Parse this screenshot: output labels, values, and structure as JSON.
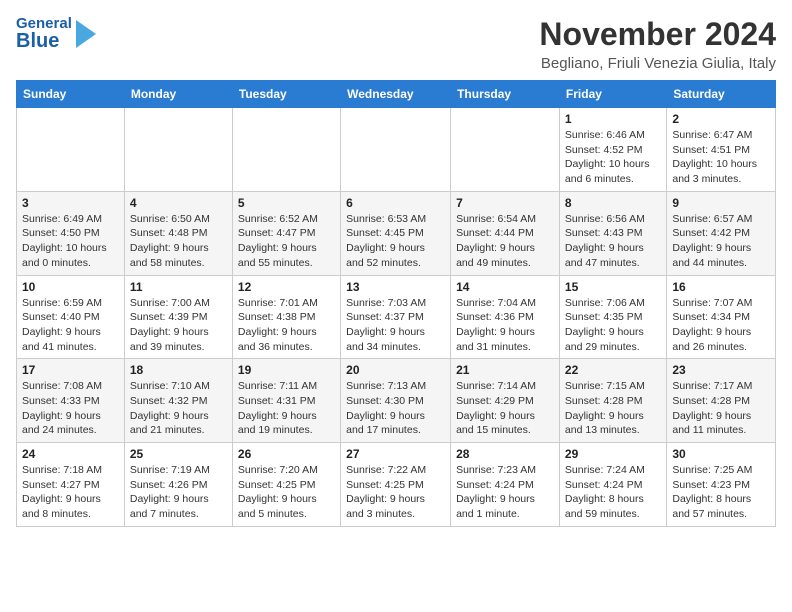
{
  "header": {
    "logo_general": "General",
    "logo_blue": "Blue",
    "title": "November 2024",
    "subtitle": "Begliano, Friuli Venezia Giulia, Italy"
  },
  "days_of_week": [
    "Sunday",
    "Monday",
    "Tuesday",
    "Wednesday",
    "Thursday",
    "Friday",
    "Saturday"
  ],
  "weeks": [
    {
      "days": [
        {
          "num": "",
          "detail": ""
        },
        {
          "num": "",
          "detail": ""
        },
        {
          "num": "",
          "detail": ""
        },
        {
          "num": "",
          "detail": ""
        },
        {
          "num": "",
          "detail": ""
        },
        {
          "num": "1",
          "detail": "Sunrise: 6:46 AM\nSunset: 4:52 PM\nDaylight: 10 hours\nand 6 minutes."
        },
        {
          "num": "2",
          "detail": "Sunrise: 6:47 AM\nSunset: 4:51 PM\nDaylight: 10 hours\nand 3 minutes."
        }
      ]
    },
    {
      "days": [
        {
          "num": "3",
          "detail": "Sunrise: 6:49 AM\nSunset: 4:50 PM\nDaylight: 10 hours\nand 0 minutes."
        },
        {
          "num": "4",
          "detail": "Sunrise: 6:50 AM\nSunset: 4:48 PM\nDaylight: 9 hours\nand 58 minutes."
        },
        {
          "num": "5",
          "detail": "Sunrise: 6:52 AM\nSunset: 4:47 PM\nDaylight: 9 hours\nand 55 minutes."
        },
        {
          "num": "6",
          "detail": "Sunrise: 6:53 AM\nSunset: 4:45 PM\nDaylight: 9 hours\nand 52 minutes."
        },
        {
          "num": "7",
          "detail": "Sunrise: 6:54 AM\nSunset: 4:44 PM\nDaylight: 9 hours\nand 49 minutes."
        },
        {
          "num": "8",
          "detail": "Sunrise: 6:56 AM\nSunset: 4:43 PM\nDaylight: 9 hours\nand 47 minutes."
        },
        {
          "num": "9",
          "detail": "Sunrise: 6:57 AM\nSunset: 4:42 PM\nDaylight: 9 hours\nand 44 minutes."
        }
      ]
    },
    {
      "days": [
        {
          "num": "10",
          "detail": "Sunrise: 6:59 AM\nSunset: 4:40 PM\nDaylight: 9 hours\nand 41 minutes."
        },
        {
          "num": "11",
          "detail": "Sunrise: 7:00 AM\nSunset: 4:39 PM\nDaylight: 9 hours\nand 39 minutes."
        },
        {
          "num": "12",
          "detail": "Sunrise: 7:01 AM\nSunset: 4:38 PM\nDaylight: 9 hours\nand 36 minutes."
        },
        {
          "num": "13",
          "detail": "Sunrise: 7:03 AM\nSunset: 4:37 PM\nDaylight: 9 hours\nand 34 minutes."
        },
        {
          "num": "14",
          "detail": "Sunrise: 7:04 AM\nSunset: 4:36 PM\nDaylight: 9 hours\nand 31 minutes."
        },
        {
          "num": "15",
          "detail": "Sunrise: 7:06 AM\nSunset: 4:35 PM\nDaylight: 9 hours\nand 29 minutes."
        },
        {
          "num": "16",
          "detail": "Sunrise: 7:07 AM\nSunset: 4:34 PM\nDaylight: 9 hours\nand 26 minutes."
        }
      ]
    },
    {
      "days": [
        {
          "num": "17",
          "detail": "Sunrise: 7:08 AM\nSunset: 4:33 PM\nDaylight: 9 hours\nand 24 minutes."
        },
        {
          "num": "18",
          "detail": "Sunrise: 7:10 AM\nSunset: 4:32 PM\nDaylight: 9 hours\nand 21 minutes."
        },
        {
          "num": "19",
          "detail": "Sunrise: 7:11 AM\nSunset: 4:31 PM\nDaylight: 9 hours\nand 19 minutes."
        },
        {
          "num": "20",
          "detail": "Sunrise: 7:13 AM\nSunset: 4:30 PM\nDaylight: 9 hours\nand 17 minutes."
        },
        {
          "num": "21",
          "detail": "Sunrise: 7:14 AM\nSunset: 4:29 PM\nDaylight: 9 hours\nand 15 minutes."
        },
        {
          "num": "22",
          "detail": "Sunrise: 7:15 AM\nSunset: 4:28 PM\nDaylight: 9 hours\nand 13 minutes."
        },
        {
          "num": "23",
          "detail": "Sunrise: 7:17 AM\nSunset: 4:28 PM\nDaylight: 9 hours\nand 11 minutes."
        }
      ]
    },
    {
      "days": [
        {
          "num": "24",
          "detail": "Sunrise: 7:18 AM\nSunset: 4:27 PM\nDaylight: 9 hours\nand 8 minutes."
        },
        {
          "num": "25",
          "detail": "Sunrise: 7:19 AM\nSunset: 4:26 PM\nDaylight: 9 hours\nand 7 minutes."
        },
        {
          "num": "26",
          "detail": "Sunrise: 7:20 AM\nSunset: 4:25 PM\nDaylight: 9 hours\nand 5 minutes."
        },
        {
          "num": "27",
          "detail": "Sunrise: 7:22 AM\nSunset: 4:25 PM\nDaylight: 9 hours\nand 3 minutes."
        },
        {
          "num": "28",
          "detail": "Sunrise: 7:23 AM\nSunset: 4:24 PM\nDaylight: 9 hours\nand 1 minute."
        },
        {
          "num": "29",
          "detail": "Sunrise: 7:24 AM\nSunset: 4:24 PM\nDaylight: 8 hours\nand 59 minutes."
        },
        {
          "num": "30",
          "detail": "Sunrise: 7:25 AM\nSunset: 4:23 PM\nDaylight: 8 hours\nand 57 minutes."
        }
      ]
    }
  ]
}
